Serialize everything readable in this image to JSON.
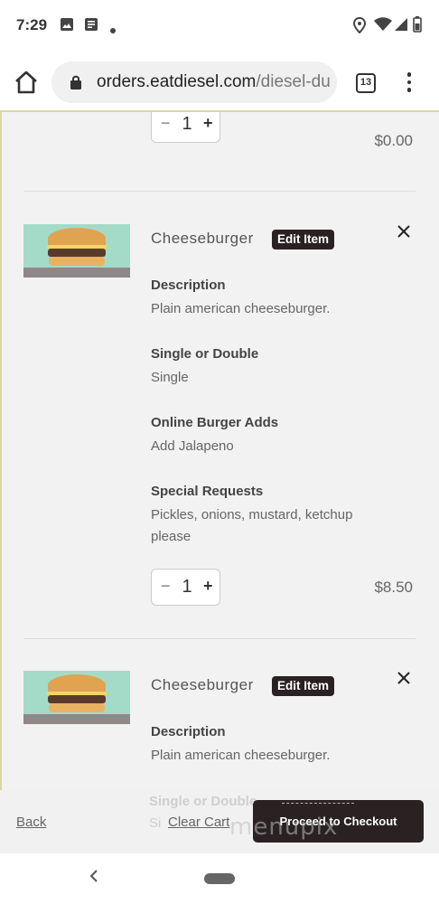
{
  "status_bar": {
    "time": "7:29",
    "left_icons": [
      "image-icon",
      "news-icon",
      "dot-icon"
    ],
    "right_icons": [
      "location-icon",
      "wifi-icon",
      "signal-icon",
      "battery-icon"
    ]
  },
  "browser": {
    "url_host": "orders.eatdiesel.com",
    "url_path": "/diesel-du",
    "tab_count": "13"
  },
  "cart": {
    "first_item": {
      "quantity": "1",
      "price": "$0.00"
    },
    "items": [
      {
        "name": "Cheeseburger",
        "edit_label": "Edit Item",
        "description_label": "Description",
        "description": "Plain american cheeseburger.",
        "option1_label": "Single or Double",
        "option1_value": "Single",
        "option2_label": "Online Burger Adds",
        "option2_value": "Add Jalapeno",
        "requests_label": "Special Requests",
        "requests_value": "Pickles, onions, mustard, ketchup please",
        "quantity": "1",
        "price": "$8.50"
      },
      {
        "name": "Cheeseburger",
        "edit_label": "Edit Item",
        "description_label": "Description",
        "description": "Plain american cheeseburger.",
        "option1_label": "Single or Double",
        "option1_value_partial": "Si"
      }
    ]
  },
  "footer": {
    "back_label": "Back",
    "clear_label": "Clear Cart",
    "checkout_label": "Proceed to Checkout",
    "watermark": "menupix"
  },
  "colors": {
    "dark_button": "#2a2222",
    "page_bg": "#f2f2f2"
  }
}
